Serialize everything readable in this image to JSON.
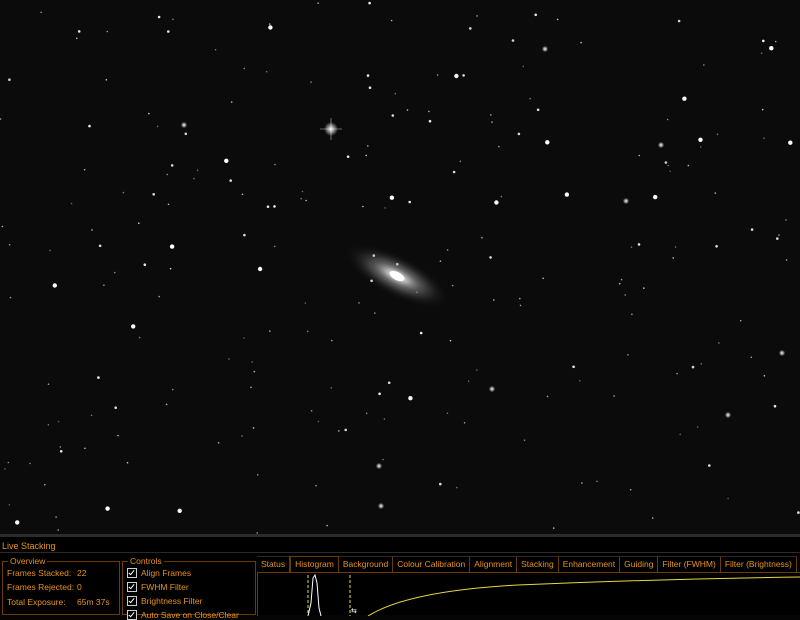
{
  "panel": {
    "title": "Live Stacking",
    "overview": {
      "title": "Overview",
      "frames_stacked_label": "Frames Stacked:",
      "frames_stacked_value": "22",
      "frames_rejected_label": "Frames Rejected:",
      "frames_rejected_value": "0",
      "total_exposure_label": "Total Exposure:",
      "total_exposure_value": "65m 37s"
    },
    "controls": {
      "title": "Controls",
      "items": [
        {
          "label": "Align Frames",
          "checked": true
        },
        {
          "label": "FWHM Filter",
          "checked": true
        },
        {
          "label": "Brightness Filter",
          "checked": true
        },
        {
          "label": "Auto Save on Close/Clear",
          "checked": true
        }
      ]
    },
    "tabs": [
      {
        "label": "Status",
        "active": false
      },
      {
        "label": "Histogram",
        "active": true
      },
      {
        "label": "Background",
        "active": false
      },
      {
        "label": "Colour Calibration",
        "active": false
      },
      {
        "label": "Alignment",
        "active": false
      },
      {
        "label": "Stacking",
        "active": false
      },
      {
        "label": "Enhancement",
        "active": false
      },
      {
        "label": "Guiding",
        "active": false
      },
      {
        "label": "Filter (FWHM)",
        "active": false
      },
      {
        "label": "Filter (Brightness)",
        "active": false
      }
    ]
  },
  "colors": {
    "accent": "#e8921a",
    "curve": "#e8d840",
    "histogram": "#ffffff"
  }
}
